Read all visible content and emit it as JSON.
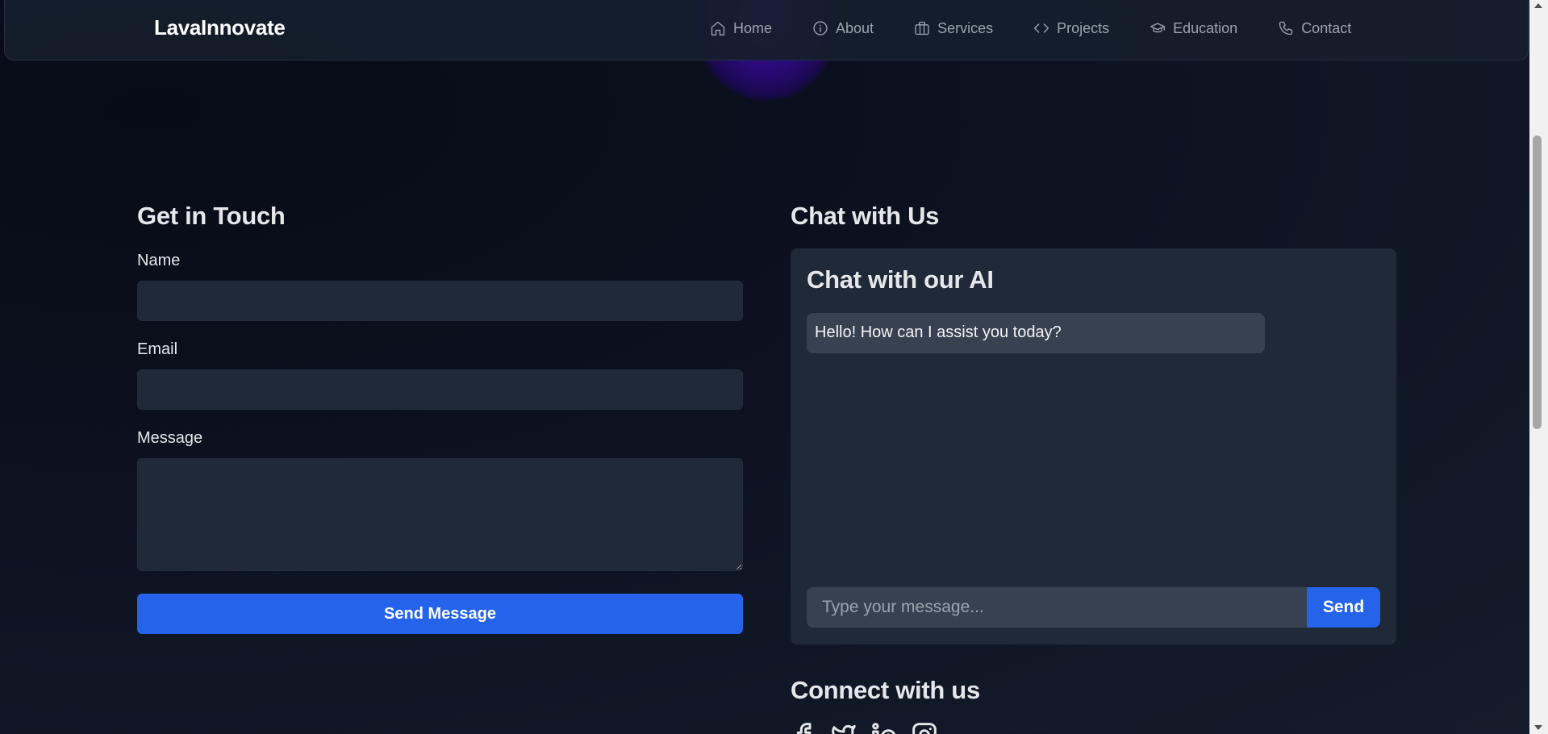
{
  "nav": {
    "brand": "LavaInnovate",
    "links": [
      {
        "label": "Home",
        "icon": "home-icon"
      },
      {
        "label": "About",
        "icon": "info-icon"
      },
      {
        "label": "Services",
        "icon": "briefcase-icon"
      },
      {
        "label": "Projects",
        "icon": "code-icon"
      },
      {
        "label": "Education",
        "icon": "graduation-cap-icon"
      },
      {
        "label": "Contact",
        "icon": "phone-icon"
      }
    ]
  },
  "contact": {
    "heading": "Get in Touch",
    "name_label": "Name",
    "name_value": "",
    "email_label": "Email",
    "email_value": "",
    "message_label": "Message",
    "message_value": "",
    "submit_label": "Send Message"
  },
  "chat": {
    "heading": "Chat with Us",
    "panel_title": "Chat with our AI",
    "messages": [
      "Hello! How can I assist you today?"
    ],
    "input_placeholder": "Type your message...",
    "send_label": "Send"
  },
  "connect": {
    "heading": "Connect with us",
    "icons": [
      "facebook-icon",
      "twitter-icon",
      "linkedin-icon",
      "instagram-icon"
    ]
  },
  "colors": {
    "accent": "#2563eb",
    "panel": "#1f2937",
    "input": "#374151",
    "glow": "#3a0c9c"
  }
}
